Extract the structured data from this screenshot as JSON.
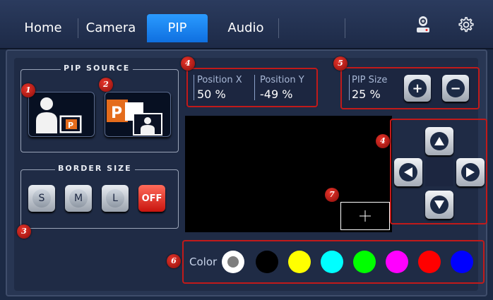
{
  "nav": {
    "tabs": [
      {
        "label": "Home"
      },
      {
        "label": "Camera"
      },
      {
        "label": "PIP"
      },
      {
        "label": "Audio"
      }
    ],
    "active_tab": "PIP",
    "camera_icon": "camera-icon",
    "settings_icon": "gear-icon"
  },
  "pip_source": {
    "legend": "PIP SOURCE",
    "buttons": [
      {
        "icon": "person-with-slide-icon"
      },
      {
        "icon": "slide-with-person-icon"
      }
    ]
  },
  "border_size": {
    "legend": "BORDER  SIZE",
    "options": [
      "S",
      "M",
      "L",
      "OFF"
    ],
    "selected": "OFF"
  },
  "position": {
    "x_label": "Position X",
    "x_value": "50 %",
    "y_label": "Position Y",
    "y_value": "-49 %"
  },
  "pip_size": {
    "label": "PIP Size",
    "value": "25 %",
    "increase_label": "+",
    "decrease_label": "−"
  },
  "color": {
    "label": "Color",
    "swatches": [
      "#ffffff",
      "#000000",
      "#ffff00",
      "#00ffff",
      "#00ff00",
      "#ff00ff",
      "#ff0000",
      "#0000ff"
    ],
    "selected": "#ffffff"
  },
  "badges": [
    "1",
    "2",
    "3",
    "4",
    "4",
    "5",
    "6",
    "7"
  ],
  "colors": {
    "accent": "#1a87f5",
    "highlight_border": "#c11a1a"
  }
}
